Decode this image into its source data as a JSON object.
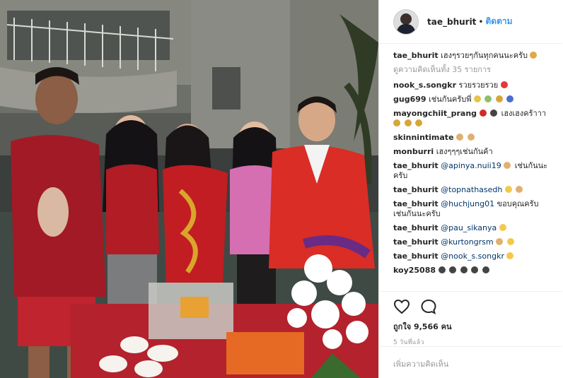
{
  "post": {
    "username": "tae_bhurit",
    "separator": "•",
    "follow_label": "ติดตาม",
    "caption_user": "tae_bhurit",
    "caption_text": "เฮงๆรวยๆกันทุกคนนะครับ",
    "view_all_comments": "ดูความคิดเห็นทั้ง 35 รายการ",
    "likes_label": "ถูกใจ 9,566 คน",
    "timestamp": "5 วันที่แล้ว",
    "add_comment_placeholder": "เพิ่มความคิดเห็น"
  },
  "comments": [
    {
      "user": "nook_s.songkr",
      "text": "รวยรวยรวย"
    },
    {
      "user": "gug699",
      "text": "เช่นกันครับพี่"
    },
    {
      "user": "mayongchiit_prang",
      "text": "เฮงเฮงคร้าาา"
    },
    {
      "user": "skinnintimate",
      "text": ""
    },
    {
      "user": "monburri",
      "text": "เฮงๆๆๆเช่นกันค้า"
    },
    {
      "user": "tae_bhurit",
      "mention": "@apinya.nuii19",
      "text": "เช่นกันนะครับ"
    },
    {
      "user": "tae_bhurit",
      "mention": "@topnathasedh",
      "text": ""
    },
    {
      "user": "tae_bhurit",
      "mention": "@huchjung01",
      "text": "ขอบคุณครับ เช่นกันนะครับ"
    },
    {
      "user": "tae_bhurit",
      "mention": "@pau_sikanya",
      "text": ""
    },
    {
      "user": "tae_bhurit",
      "mention": "@kurtongrsm",
      "text": ""
    },
    {
      "user": "tae_bhurit",
      "mention": "@nook_s.songkr",
      "text": ""
    },
    {
      "user": "koy25088",
      "text": ""
    }
  ],
  "icons": {
    "like": "heart-icon",
    "comment": "comment-icon"
  },
  "colors": {
    "link": "#3897f0",
    "mention": "#003569",
    "muted": "#999999"
  }
}
